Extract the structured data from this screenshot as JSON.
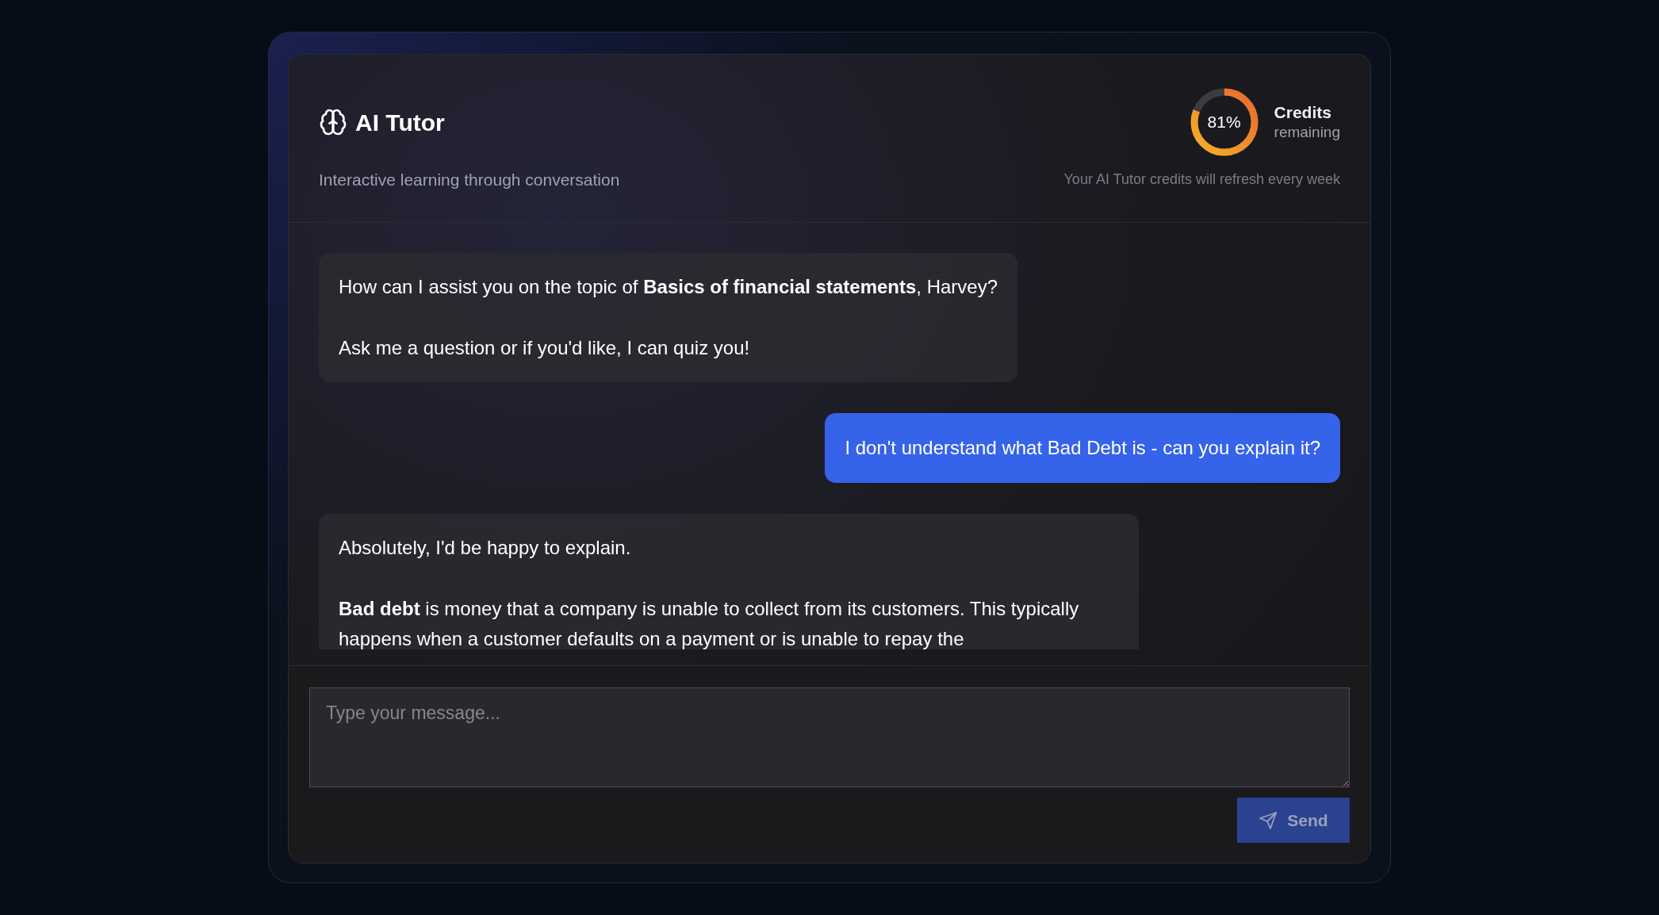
{
  "header": {
    "title": "AI Tutor",
    "subtitle": "Interactive learning through conversation",
    "credits": {
      "percent": "81%",
      "level": 0.81,
      "label": "Credits",
      "sublabel": "remaining",
      "note": "Your AI Tutor credits will refresh every week"
    }
  },
  "messages": [
    {
      "kind": "assistant",
      "paragraphs": [
        "How can I assist you on the topic of **Basics of financial statements**, Harvey?",
        "Ask me a question or if you'd like, I can quiz you!"
      ]
    },
    {
      "kind": "user",
      "paragraphs": [
        "I don't understand what Bad Debt is - can you explain it?"
      ]
    },
    {
      "kind": "assistant",
      "paragraphs": [
        "Absolutely, I'd be happy to explain.",
        "**Bad debt** is money that a company is unable to collect from its customers. This typically happens when a customer defaults on a payment or is unable to repay the"
      ]
    }
  ],
  "composer": {
    "placeholder": "Type your message...",
    "send": {
      "label": "Send",
      "disabled": true
    }
  }
}
